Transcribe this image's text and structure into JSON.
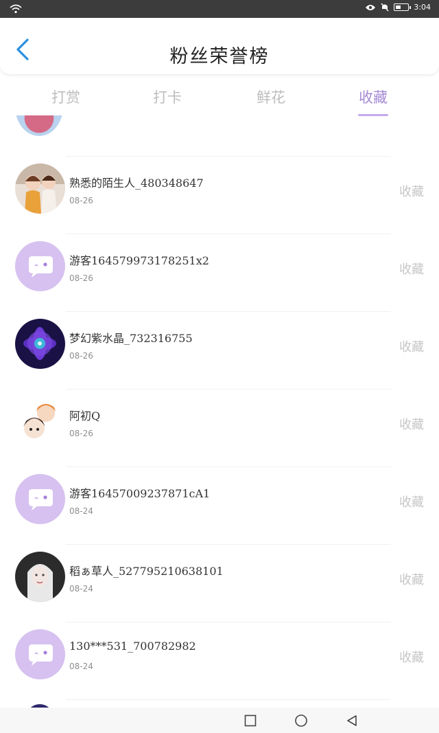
{
  "status_bar": {
    "time": "3:04",
    "icons": [
      "wifi-icon",
      "eye-icon",
      "bell-off-icon",
      "battery-icon"
    ]
  },
  "header": {
    "title": "粉丝荣誉榜",
    "back_icon": "chevron-left-icon"
  },
  "colors": {
    "accent": "#a58ad4",
    "accent_underline": "#c4a9ec",
    "back_icon": "#2a8fe0",
    "guest_avatar_bg": "#d6c1f0"
  },
  "tabs": [
    {
      "label": "打赏",
      "active": false
    },
    {
      "label": "打卡",
      "active": false
    },
    {
      "label": "鲜花",
      "active": false
    },
    {
      "label": "收藏",
      "active": true
    }
  ],
  "list": {
    "items": [
      {
        "name": "熟悉的陌生人_480348647",
        "date": "08-26",
        "action": "收藏",
        "avatar": "photo-avatar-girls"
      },
      {
        "name": "游客1645799731782​51x2",
        "date": "08-26",
        "action": "收藏",
        "avatar": "chat-bubble-avatar"
      },
      {
        "name": "梦幻紫水晶_732316755",
        "date": "08-26",
        "action": "收藏",
        "avatar": "purple-flower-avatar"
      },
      {
        "name": "阿初Q",
        "date": "08-26",
        "action": "收藏",
        "avatar": "anime-avatar"
      },
      {
        "name": "游客16457009237871cA1",
        "date": "08-24",
        "action": "收藏",
        "avatar": "chat-bubble-avatar"
      },
      {
        "name": "稻ぁ草人_527795210638101",
        "date": "08-24",
        "action": "收藏",
        "avatar": "photo-avatar-portrait"
      },
      {
        "name": "130***531_700782982",
        "date": "08-24",
        "action": "收藏",
        "avatar": "chat-bubble-avatar"
      }
    ]
  },
  "nav_bar": {
    "icons": [
      "recent-apps-icon",
      "home-icon",
      "back-triangle-icon"
    ]
  }
}
